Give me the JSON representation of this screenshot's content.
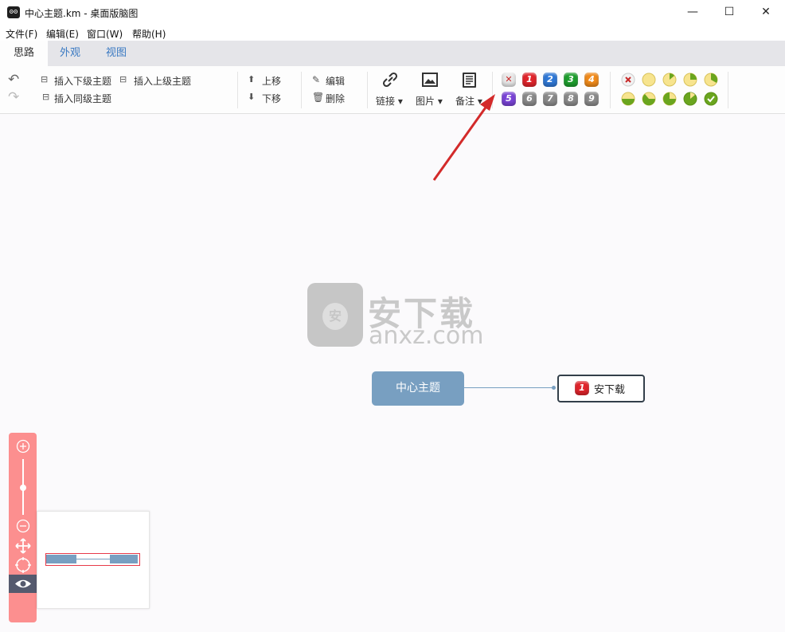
{
  "window": {
    "title": "中心主题.km - 桌面版脑图",
    "icon": "owl-app-icon",
    "minimize": "—",
    "maximize": "☐",
    "close": "✕"
  },
  "menu": [
    "文件(F)",
    "编辑(E)",
    "窗口(W)",
    "帮助(H)"
  ],
  "tabs": [
    "思路",
    "外观",
    "视图"
  ],
  "toolbar": {
    "insert_child": "插入下级主题",
    "insert_parent": "插入上级主题",
    "insert_sibling": "插入同级主题",
    "move_up": "上移",
    "move_down": "下移",
    "edit": "编辑",
    "delete": "删除",
    "link": "链接",
    "image": "图片",
    "note": "备注",
    "priorities": [
      "1",
      "2",
      "3",
      "4",
      "5",
      "6",
      "7",
      "8",
      "9"
    ],
    "priority_colors": [
      "#e0242b",
      "#2f78d6",
      "#1e9e2e",
      "#f08a1a",
      "#7a44d6",
      "#8a8a8a",
      "#8a8a8a",
      "#8a8a8a",
      "#8a8a8a"
    ],
    "progress_count": 9
  },
  "canvas": {
    "center_topic": "中心主题",
    "child_topic": "安下载",
    "child_priority": "1",
    "watermark_cn": "安下载",
    "watermark_en": "anxz.com",
    "watermark_shield": "安"
  },
  "accent": "#789fc1",
  "annotation_arrow_color": "#d32a2a"
}
